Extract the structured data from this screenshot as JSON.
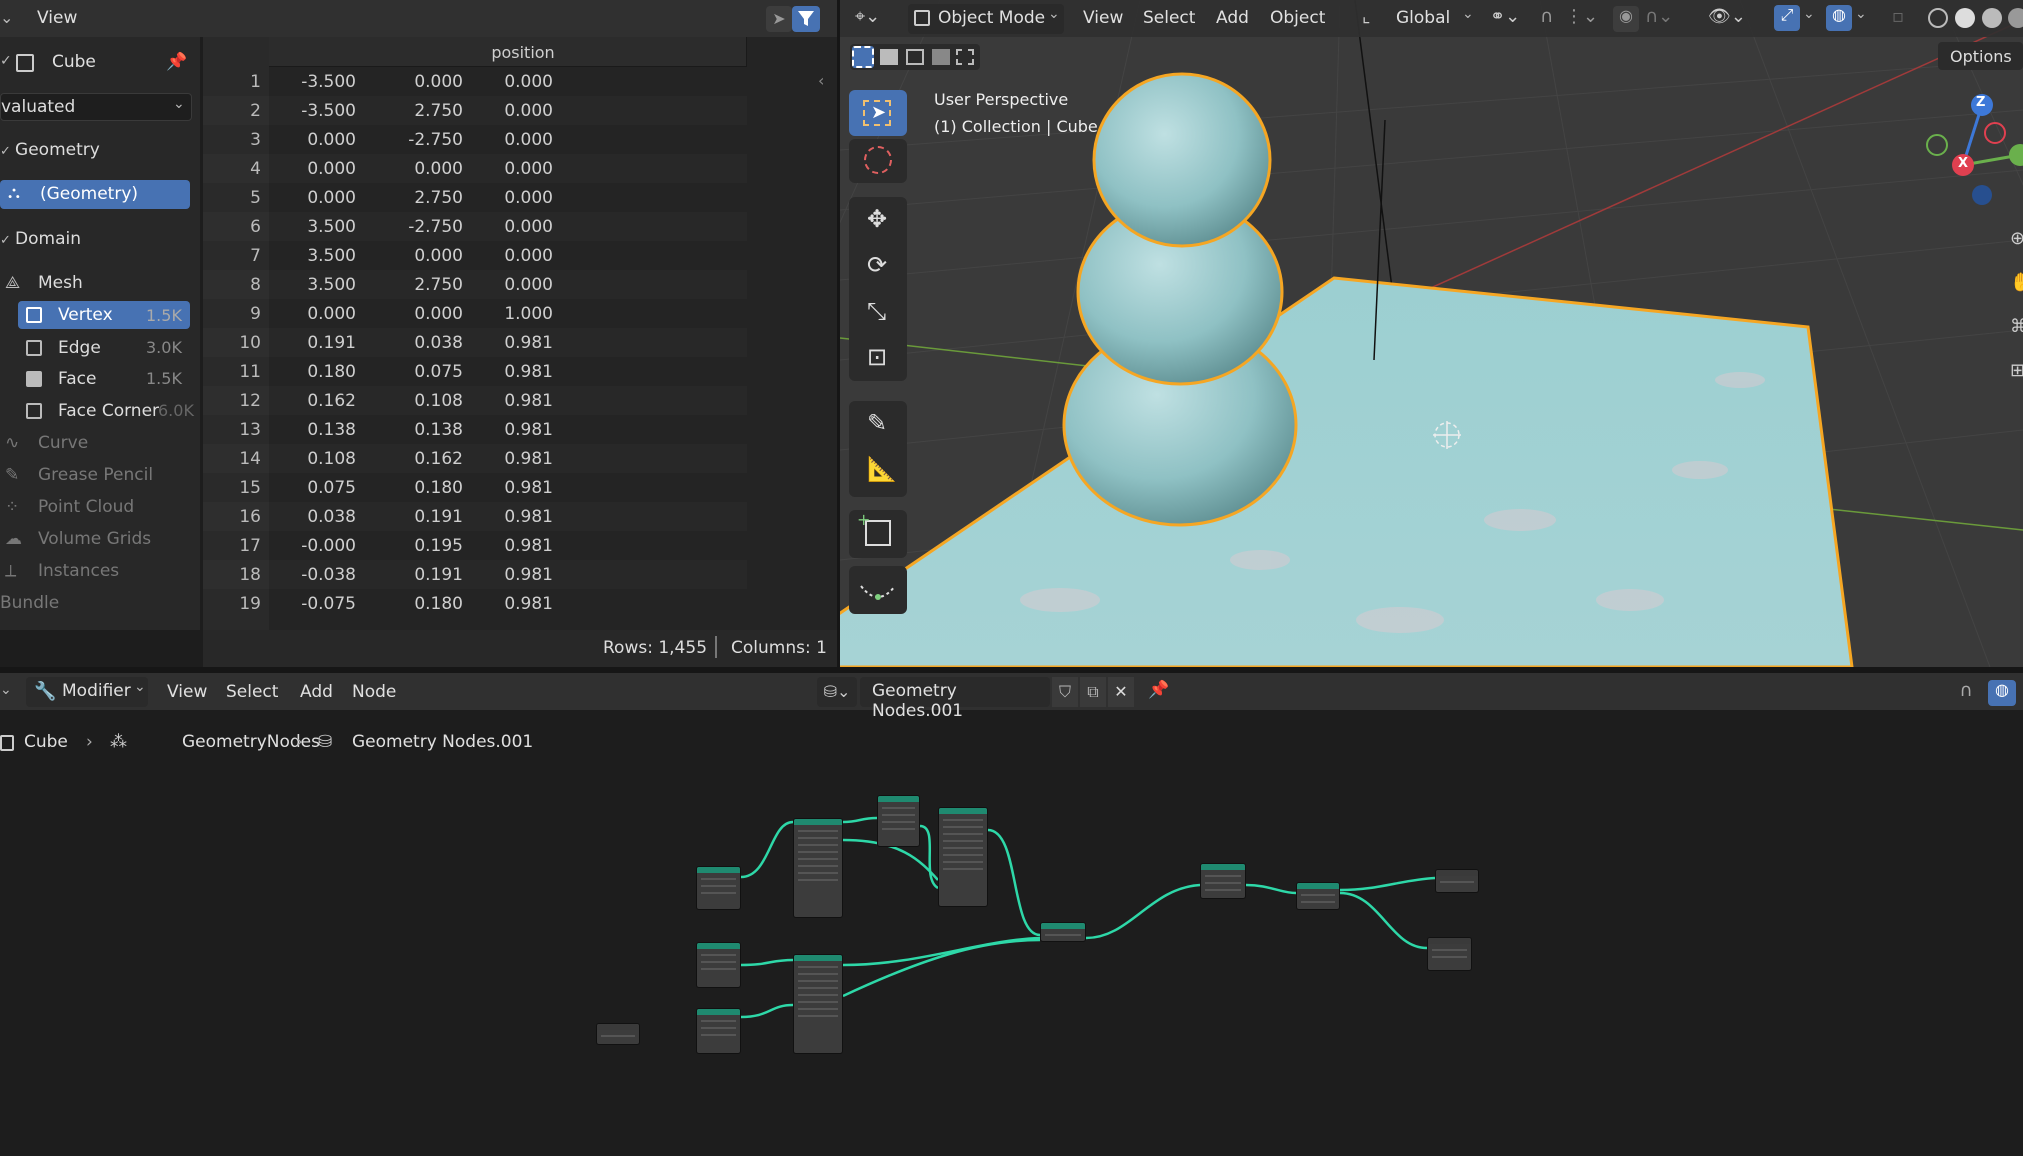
{
  "spreadsheet": {
    "menu_view": "View",
    "object_name": "Cube",
    "evaluated": "valuated",
    "geometry_label": "Geometry",
    "geometry_item": "(Geometry)",
    "domain_label": "Domain",
    "mesh_label": "Mesh",
    "domains": [
      {
        "label": "Vertex",
        "count": "1.5K"
      },
      {
        "label": "Edge",
        "count": "3.0K"
      },
      {
        "label": "Face",
        "count": "1.5K"
      },
      {
        "label": "Face Corner",
        "count": "6.0K"
      }
    ],
    "other": [
      "Curve",
      "Grease Pencil",
      "Point Cloud",
      "Volume Grids",
      "Instances",
      "Bundle"
    ],
    "column_header": "position",
    "rows": [
      [
        "1",
        "-3.500",
        "0.000",
        "0.000"
      ],
      [
        "2",
        "-3.500",
        "2.750",
        "0.000"
      ],
      [
        "3",
        "0.000",
        "-2.750",
        "0.000"
      ],
      [
        "4",
        "0.000",
        "0.000",
        "0.000"
      ],
      [
        "5",
        "0.000",
        "2.750",
        "0.000"
      ],
      [
        "6",
        "3.500",
        "-2.750",
        "0.000"
      ],
      [
        "7",
        "3.500",
        "0.000",
        "0.000"
      ],
      [
        "8",
        "3.500",
        "2.750",
        "0.000"
      ],
      [
        "9",
        "0.000",
        "0.000",
        "1.000"
      ],
      [
        "10",
        "0.191",
        "0.038",
        "0.981"
      ],
      [
        "11",
        "0.180",
        "0.075",
        "0.981"
      ],
      [
        "12",
        "0.162",
        "0.108",
        "0.981"
      ],
      [
        "13",
        "0.138",
        "0.138",
        "0.981"
      ],
      [
        "14",
        "0.108",
        "0.162",
        "0.981"
      ],
      [
        "15",
        "0.075",
        "0.180",
        "0.981"
      ],
      [
        "16",
        "0.038",
        "0.191",
        "0.981"
      ],
      [
        "17",
        "-0.000",
        "0.195",
        "0.981"
      ],
      [
        "18",
        "-0.038",
        "0.191",
        "0.981"
      ],
      [
        "19",
        "-0.075",
        "0.180",
        "0.981"
      ]
    ],
    "rows_status": "Rows: 1,455",
    "cols_status": "Columns: 1"
  },
  "viewport": {
    "mode": "Object Mode",
    "menus": [
      "View",
      "Select",
      "Add",
      "Object"
    ],
    "orientation": "Global",
    "options": "Options",
    "perspective": "User Perspective",
    "collection": "(1) Collection | Cube",
    "axis_x": "X",
    "axis_y": "Y",
    "axis_z": "Z"
  },
  "node_editor": {
    "editor_type": "Modifier",
    "menus": [
      "View",
      "Select",
      "Add",
      "Node"
    ],
    "tree_name": "Geometry Nodes.001",
    "breadcrumb": [
      "Cube",
      "GeometryNodes",
      "Geometry Nodes.001"
    ]
  },
  "colors": {
    "accent": "#4772b3",
    "node_header": "#1f8a70",
    "link": "#2ed8a8",
    "selection": "#f5a623"
  }
}
